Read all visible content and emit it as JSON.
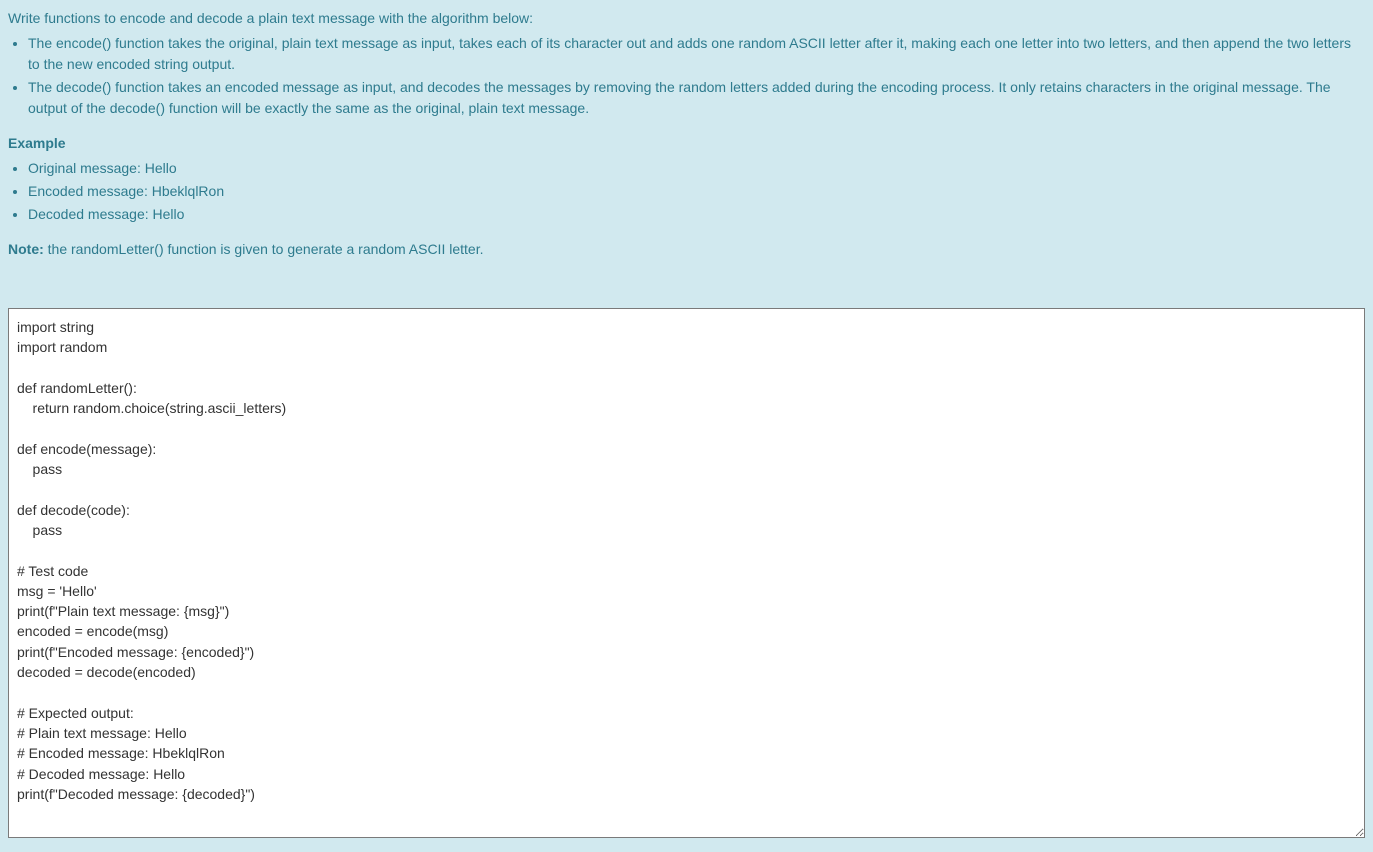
{
  "problem": {
    "intro": "Write functions to encode and decode a plain text message with the algorithm below:",
    "bullets": [
      "The encode() function takes the original, plain text message as input, takes each of its character out and adds one random ASCII letter after it, making each one letter into two letters, and then append the two letters to the new encoded string output.",
      "The decode() function takes an encoded message as input, and decodes the messages by removing the random letters added during the encoding process. It only retains characters in the original message. The output of the decode() function will be exactly the same as the original, plain text message."
    ],
    "example_label": "Example",
    "example_items": [
      "Original message: Hello",
      "Encoded message: HbeklqlRon",
      "Decoded message: Hello"
    ],
    "note_label": "Note:",
    "note_text": " the randomLetter() function is given to generate a random ASCII letter."
  },
  "editor": {
    "code": "import string\nimport random\n\ndef randomLetter():\n    return random.choice(string.ascii_letters)\n\ndef encode(message):\n    pass\n\ndef decode(code):\n    pass\n\n# Test code\nmsg = 'Hello'\nprint(f\"Plain text message: {msg}\")\nencoded = encode(msg)\nprint(f\"Encoded message: {encoded}\")\ndecoded = decode(encoded)\n\n# Expected output:\n# Plain text message: Hello\n# Encoded message: HbeklqlRon\n# Decoded message: Hello\nprint(f\"Decoded message: {decoded}\")"
  }
}
